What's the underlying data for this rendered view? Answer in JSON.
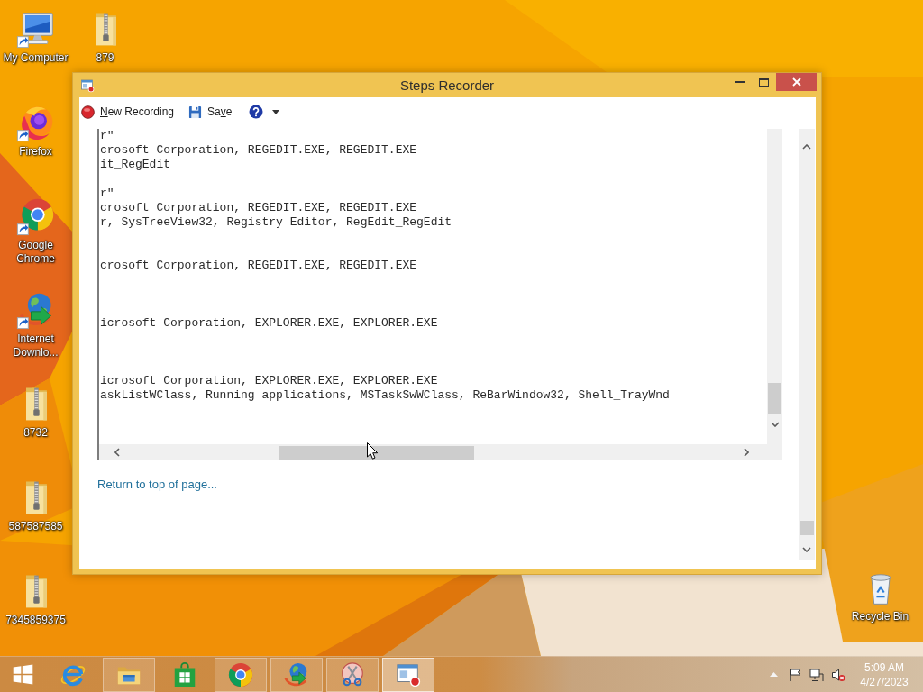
{
  "desktop": {
    "icons": [
      {
        "label": "My Computer",
        "kind": "computer",
        "shortcut": true
      },
      {
        "label": "Firefox",
        "kind": "firefox",
        "shortcut": true
      },
      {
        "label": "Google Chrome",
        "kind": "chrome",
        "shortcut": true
      },
      {
        "label": "Internet Downlo...",
        "kind": "downloader",
        "shortcut": true
      },
      {
        "label": "8732",
        "kind": "archive",
        "shortcut": false
      },
      {
        "label": "587587585",
        "kind": "archive",
        "shortcut": false
      },
      {
        "label": "7345859375",
        "kind": "archive",
        "shortcut": false
      },
      {
        "label": "879",
        "kind": "archive",
        "shortcut": false
      }
    ],
    "corner_icons": [
      {
        "label": "Recycle Bin",
        "kind": "bin",
        "shortcut": false
      }
    ]
  },
  "window": {
    "title": "Steps Recorder",
    "toolbar": [
      {
        "kind": "record",
        "label": [
          {
            "text": "N",
            "underlined": true
          },
          {
            "text": "ew Recording",
            "underlined": false
          }
        ]
      },
      {
        "kind": "save",
        "label": [
          {
            "text": "Sa",
            "underlined": false
          },
          {
            "text": "v",
            "underlined": true
          },
          {
            "text": "e",
            "underlined": false
          }
        ]
      },
      {
        "kind": "help"
      }
    ],
    "details": [
      [
        "r\"",
        "crosoft Corporation, REGEDIT.EXE, REGEDIT.EXE",
        "it_RegEdit"
      ],
      [
        "r\"",
        "crosoft Corporation, REGEDIT.EXE, REGEDIT.EXE",
        "r, SysTreeView32, Registry Editor, RegEdit_RegEdit"
      ],
      [
        "crosoft Corporation, REGEDIT.EXE, REGEDIT.EXE"
      ],
      [
        "icrosoft Corporation, EXPLORER.EXE, EXPLORER.EXE"
      ],
      [
        "icrosoft Corporation, EXPLORER.EXE, EXPLORER.EXE",
        "askListWClass, Running applications, MSTaskSwWClass, ReBarWindow32, Shell_TrayWnd"
      ]
    ],
    "link": "Return to top of page..."
  },
  "taskbar": {
    "apps": [
      {
        "kind": "ie",
        "running": false,
        "selected": false
      },
      {
        "kind": "explorer",
        "running": true,
        "selected": false
      },
      {
        "kind": "store",
        "running": false,
        "selected": false
      },
      {
        "kind": "chrome",
        "running": true,
        "selected": false
      },
      {
        "kind": "downloader",
        "running": true,
        "selected": false
      },
      {
        "kind": "snipping",
        "running": true,
        "selected": false
      },
      {
        "kind": "steps",
        "running": true,
        "selected": true
      }
    ],
    "tray": [
      {
        "kind": "show_hidden"
      },
      {
        "kind": "flag"
      },
      {
        "kind": "network"
      }
    ],
    "volume": {
      "muted": true
    },
    "time": "5:09 AM",
    "date": "4/27/2023"
  }
}
